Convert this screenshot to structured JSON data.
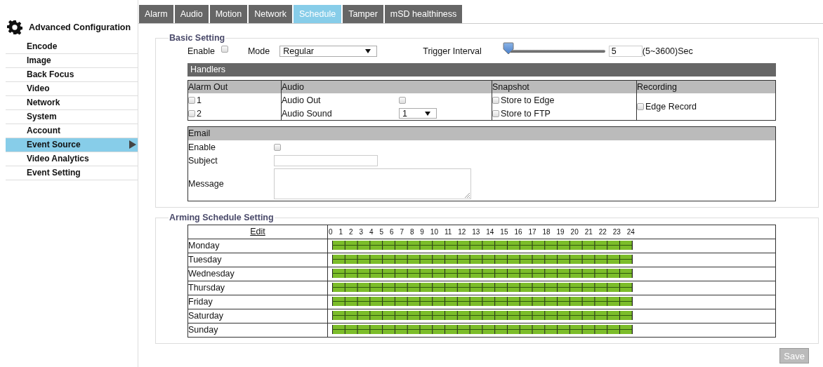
{
  "sidebar": {
    "title": "Advanced Configuration",
    "items": [
      {
        "label": "Encode",
        "selected": false
      },
      {
        "label": "Image",
        "selected": false
      },
      {
        "label": "Back Focus",
        "selected": false
      },
      {
        "label": "Video",
        "selected": false
      },
      {
        "label": "Network",
        "selected": false
      },
      {
        "label": "System",
        "selected": false
      },
      {
        "label": "Account",
        "selected": false
      },
      {
        "label": "Event Source",
        "selected": true
      },
      {
        "label": "Video Analytics",
        "selected": false
      },
      {
        "label": "Event Setting",
        "selected": false
      }
    ]
  },
  "tabs": [
    {
      "label": "Alarm",
      "selected": false
    },
    {
      "label": "Audio",
      "selected": false
    },
    {
      "label": "Motion",
      "selected": false
    },
    {
      "label": "Network",
      "selected": false
    },
    {
      "label": "Schedule",
      "selected": true
    },
    {
      "label": "Tamper",
      "selected": false
    },
    {
      "label": "mSD healthiness",
      "selected": false
    }
  ],
  "basic_setting": {
    "title": "Basic Setting",
    "enable_label": "Enable",
    "enable_checked": false,
    "mode_label": "Mode",
    "mode_value": "Regular",
    "trigger_label": "Trigger Interval",
    "trigger_slider": {
      "level": 0
    },
    "trigger_value": "5",
    "trigger_range": "(5~3600)Sec",
    "handlers": {
      "title": "Handlers",
      "columns": [
        "Alarm Out",
        "Audio",
        "Snapshot",
        "Recording"
      ],
      "alarm_out": [
        {
          "label": "1",
          "checked": false
        },
        {
          "label": "2",
          "checked": false
        }
      ],
      "audio_out_label": "Audio Out",
      "audio_out_checked": false,
      "audio_sound_label": "Audio Sound",
      "audio_sound_value": "1",
      "snapshot": [
        {
          "label": "Store to Edge",
          "checked": false
        },
        {
          "label": "Store to FTP",
          "checked": false
        }
      ],
      "recording": [
        {
          "label": "Edge Record",
          "checked": false
        }
      ]
    },
    "email": {
      "title": "Email",
      "enable_label": "Enable",
      "enable_checked": false,
      "subject_label": "Subject",
      "message_label": "Message"
    }
  },
  "arming_schedule": {
    "title": "Arming Schedule Setting",
    "edit_link": "Edit",
    "hours": [
      "0",
      "1",
      "2",
      "3",
      "4",
      "5",
      "6",
      "7",
      "8",
      "9",
      "10",
      "11",
      "12",
      "13",
      "14",
      "15",
      "16",
      "17",
      "18",
      "19",
      "20",
      "21",
      "22",
      "23",
      "24"
    ],
    "days": [
      {
        "day": "Monday"
      },
      {
        "day": "Tuesday"
      },
      {
        "day": "Wednesday"
      },
      {
        "day": "Thursday"
      },
      {
        "day": "Friday"
      },
      {
        "day": "Saturday"
      },
      {
        "day": "Sunday"
      }
    ]
  },
  "save_button": "Save"
}
